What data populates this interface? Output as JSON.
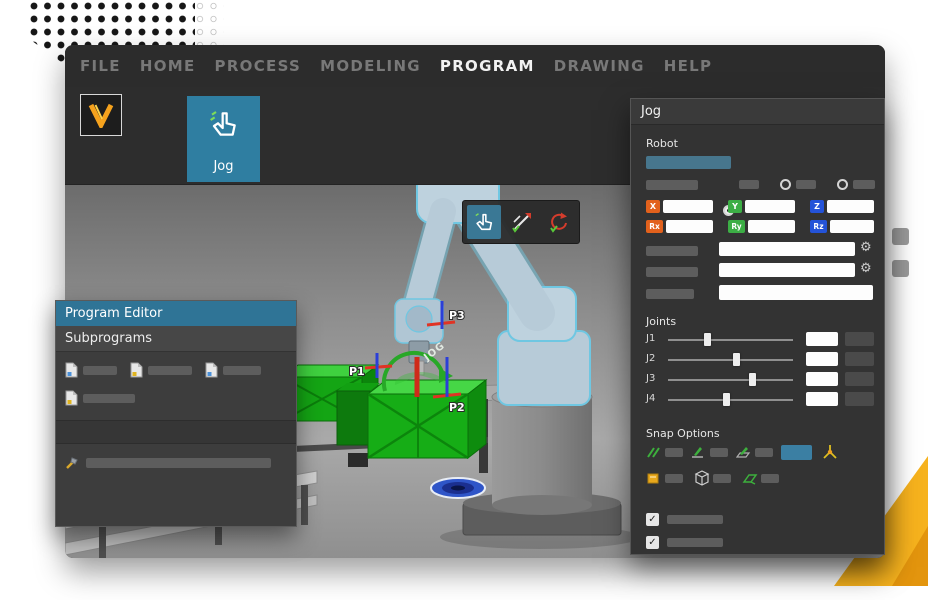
{
  "colors": {
    "accent_teal": "#2f7ea1",
    "header_teal": "#2f7496",
    "axis_x_orange": "#e2611c",
    "axis_y_green": "#3cae45",
    "axis_z_blue": "#2453d8",
    "bin_green": "#16ad16",
    "logo_orange": "#f5a21d",
    "corner_yellow": "#f6b21e",
    "window_bg": "#2d2d2d",
    "panel_bg": "#333333"
  },
  "menubar": {
    "items": [
      {
        "label": "FILE",
        "active": false
      },
      {
        "label": "HOME",
        "active": false
      },
      {
        "label": "PROCESS",
        "active": false
      },
      {
        "label": "MODELING",
        "active": false
      },
      {
        "label": "PROGRAM",
        "active": true
      },
      {
        "label": "DRAWING",
        "active": false
      },
      {
        "label": "HELP",
        "active": false
      }
    ]
  },
  "ribbon": {
    "jog_button_label": "Jog"
  },
  "viewport": {
    "markers": [
      {
        "label": "P1"
      },
      {
        "label": "P2"
      },
      {
        "label": "P3"
      }
    ],
    "jog_gizmo_label": "JOG",
    "toolbar": {
      "buttons": [
        {
          "name": "jog-select",
          "selected": true
        },
        {
          "name": "jog-linear",
          "selected": false
        },
        {
          "name": "jog-rotate",
          "selected": false
        }
      ]
    }
  },
  "program_editor": {
    "title": "Program Editor",
    "subprograms_label": "Subprograms"
  },
  "jog_panel": {
    "title": "Jog",
    "robot_label": "Robot",
    "radio_selected": 0,
    "coord_axes": [
      {
        "label": "X"
      },
      {
        "label": "Y"
      },
      {
        "label": "Z"
      }
    ],
    "rot_axes": [
      {
        "label": "Rx"
      },
      {
        "label": "Ry"
      },
      {
        "label": "Rz"
      }
    ],
    "joints_label": "Joints",
    "joints": [
      {
        "label": "J1",
        "slider_pct": 32
      },
      {
        "label": "J2",
        "slider_pct": 55
      },
      {
        "label": "J3",
        "slider_pct": 68
      },
      {
        "label": "J4",
        "slider_pct": 47
      }
    ],
    "snap_options_label": "Snap Options",
    "checkboxes": [
      {
        "checked": true
      },
      {
        "checked": true
      }
    ]
  },
  "icons": {
    "gear": "⚙",
    "check": "✓"
  }
}
